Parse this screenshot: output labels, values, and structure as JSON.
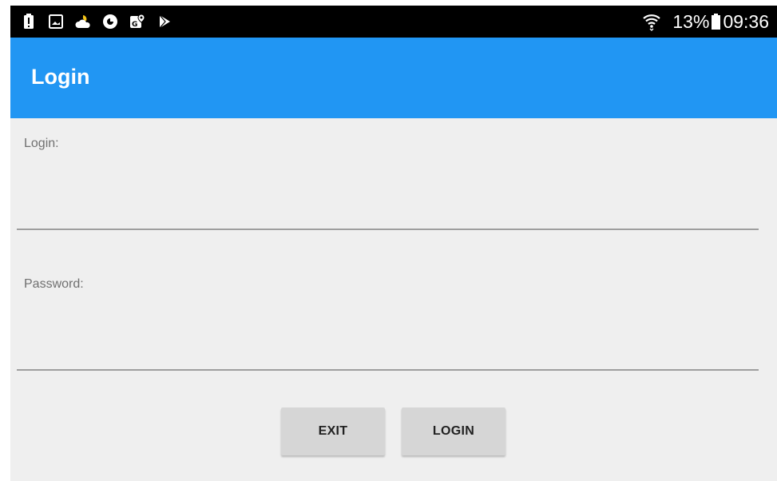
{
  "status_bar": {
    "icons_left": [
      "alert-icon",
      "gallery-icon",
      "weather-icon",
      "sync-icon",
      "maps-icon",
      "play-store-icon"
    ],
    "battery_percent": "13%",
    "battery_level": 0.13,
    "time": "09:36"
  },
  "app_bar": {
    "title": "Login"
  },
  "form": {
    "login_label": "Login:",
    "login_value": "",
    "password_label": "Password:",
    "password_value": ""
  },
  "buttons": {
    "exit_label": "EXIT",
    "login_label": "LOGIN"
  },
  "colors": {
    "app_bar": "#2196f3",
    "background": "#efefef",
    "button": "#d6d6d6",
    "status_bar": "#000000"
  }
}
